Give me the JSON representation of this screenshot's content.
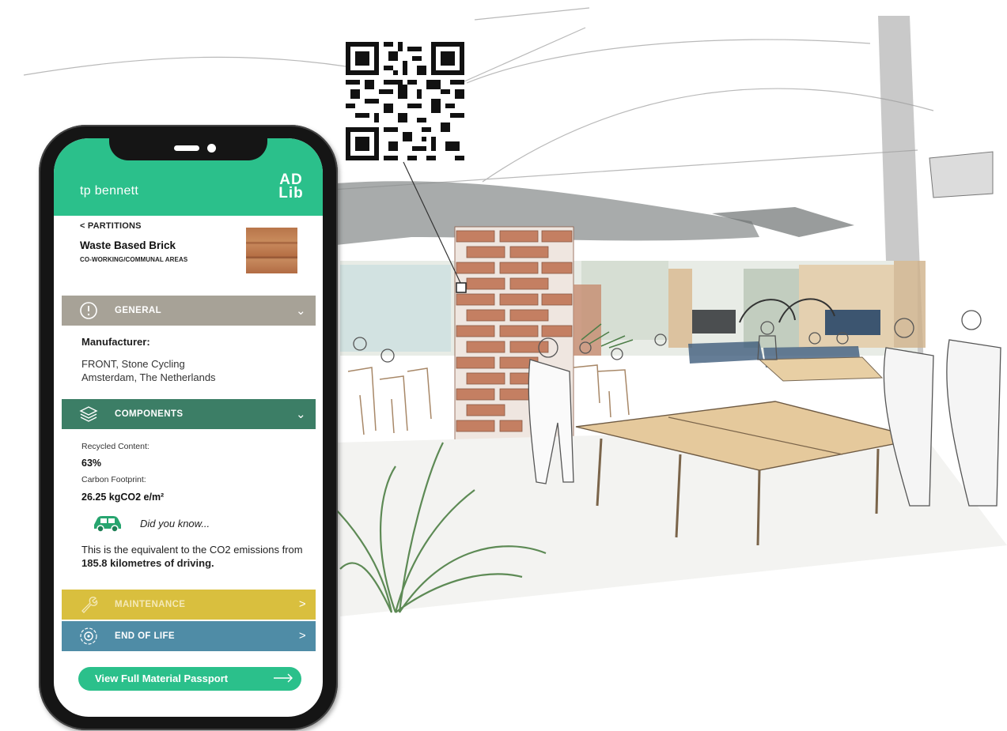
{
  "app": {
    "brand": "tp bennett",
    "logo_line1": "AD",
    "logo_line2": "Lib"
  },
  "nav": {
    "back_label": "< PARTITIONS"
  },
  "material": {
    "name": "Waste Based Brick",
    "area": "CO-WORKING/COMMUNAL AREAS",
    "swatch_color": "#b8754a"
  },
  "sections": {
    "general": {
      "label": "GENERAL",
      "icon": "info-icon",
      "chevron": "⌄",
      "color": "#a7a297"
    },
    "components": {
      "label": "COMPONENTS",
      "icon": "layers-icon",
      "chevron": "⌄",
      "color": "#3c7e66"
    },
    "maintenance": {
      "label": "MAINTENANCE",
      "icon": "wrench-icon",
      "chevron": ">",
      "color": "#d9bf3e"
    },
    "end_of_life": {
      "label": "END OF LIFE",
      "icon": "cycle-icon",
      "chevron": ">",
      "color": "#4f8ca6"
    }
  },
  "general": {
    "manufacturer_label": "Manufacturer:",
    "manufacturer_line1": "FRONT, Stone Cycling",
    "manufacturer_line2": "Amsterdam, The Netherlands"
  },
  "components": {
    "recycled_label": "Recycled Content:",
    "recycled_value": "63%",
    "carbon_label": "Carbon Footprint:",
    "carbon_value": "26.25 kgCO2 e/m²",
    "did_you_know": "Did you know...",
    "equivalent_text": "This is the equivalent to the CO2 emissions from",
    "equivalent_bold": "185.8 kilometres of driving."
  },
  "cta": {
    "label": "View Full Material Passport"
  },
  "colors": {
    "brand_green": "#2bc08b",
    "phone_body": "#151515"
  }
}
